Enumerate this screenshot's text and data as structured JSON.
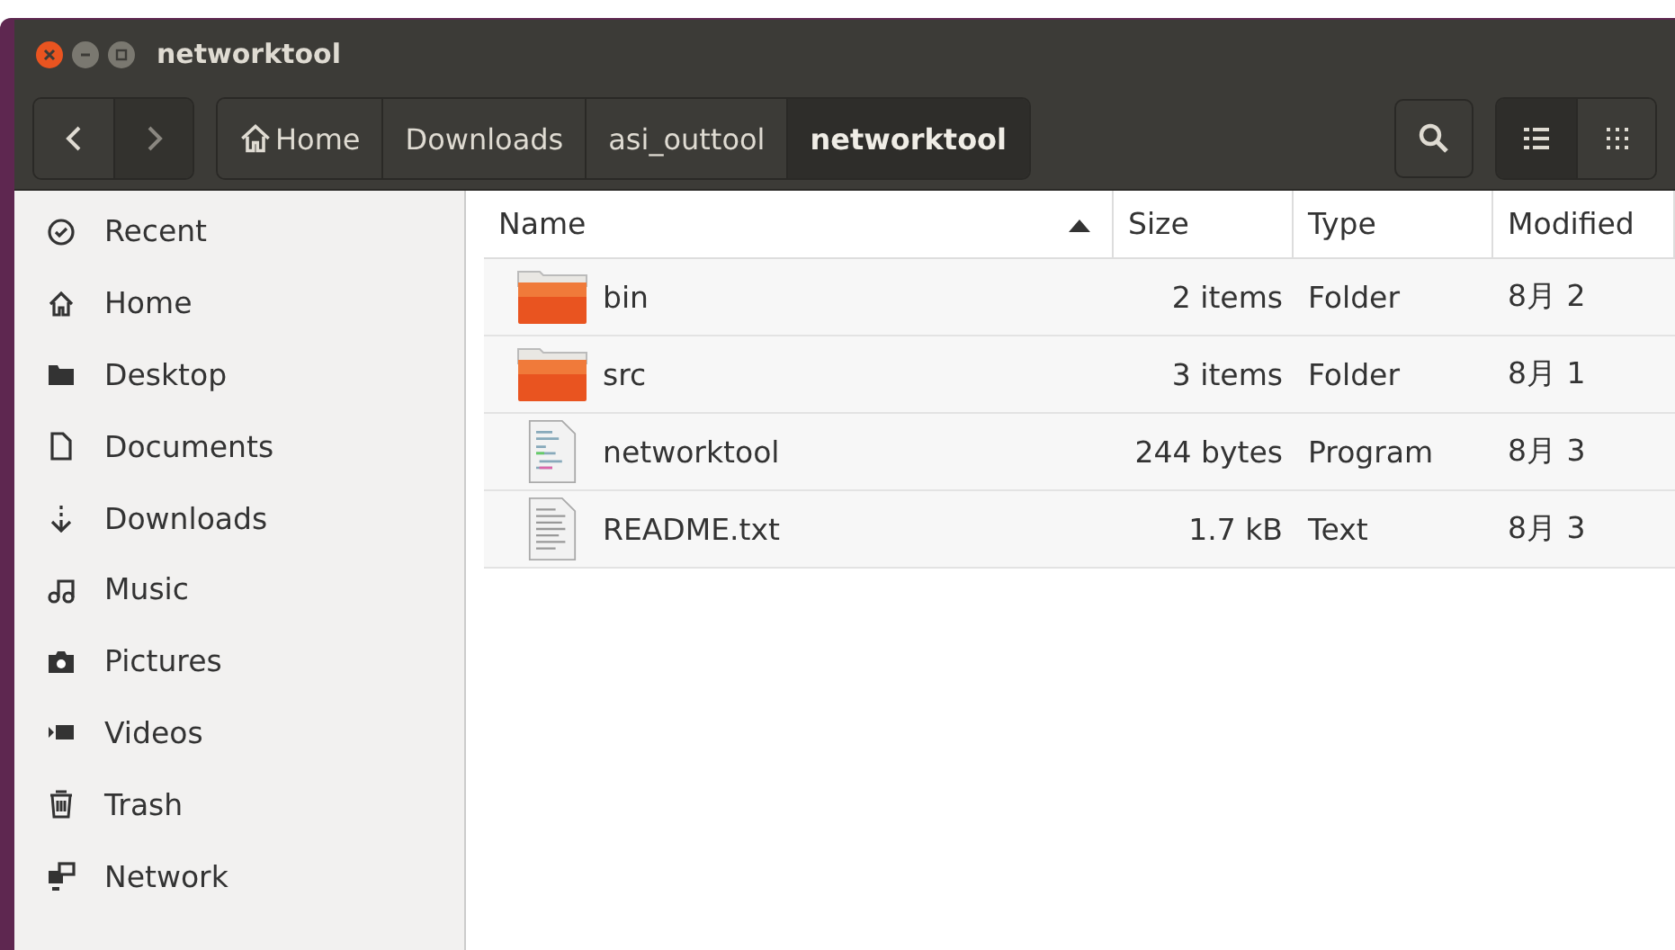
{
  "window": {
    "title": "networktool"
  },
  "breadcrumbs": [
    {
      "label": "Home",
      "kind": "home",
      "selected": false
    },
    {
      "label": "Downloads",
      "kind": "folder",
      "selected": false
    },
    {
      "label": "asi_outtool",
      "kind": "folder",
      "selected": false
    },
    {
      "label": "networktool",
      "kind": "folder",
      "selected": true
    }
  ],
  "view_buttons": [
    {
      "kind": "list",
      "selected": true
    },
    {
      "kind": "grid",
      "selected": false
    }
  ],
  "sidebar": {
    "items": [
      {
        "label": "Recent",
        "kind": "recent"
      },
      {
        "label": "Home",
        "kind": "home"
      },
      {
        "label": "Desktop",
        "kind": "desktop"
      },
      {
        "label": "Documents",
        "kind": "documents"
      },
      {
        "label": "Downloads",
        "kind": "downloads"
      },
      {
        "label": "Music",
        "kind": "music"
      },
      {
        "label": "Pictures",
        "kind": "pictures"
      },
      {
        "label": "Videos",
        "kind": "videos"
      },
      {
        "label": "Trash",
        "kind": "trash"
      },
      {
        "label": "Network",
        "kind": "network"
      }
    ]
  },
  "table": {
    "columns": [
      "Name",
      "Size",
      "Type",
      "Modified"
    ],
    "rows": [
      {
        "name": "bin",
        "kind": "folder",
        "size": "2 items",
        "type": "Folder",
        "modified": "8月 2"
      },
      {
        "name": "src",
        "kind": "folder",
        "size": "3 items",
        "type": "Folder",
        "modified": "8月 1"
      },
      {
        "name": "networktool",
        "kind": "program",
        "size": "244 bytes",
        "type": "Program",
        "modified": "8月 3"
      },
      {
        "name": "README.txt",
        "kind": "text",
        "size": "1.7 kB",
        "type": "Text",
        "modified": "8月 3"
      }
    ]
  }
}
